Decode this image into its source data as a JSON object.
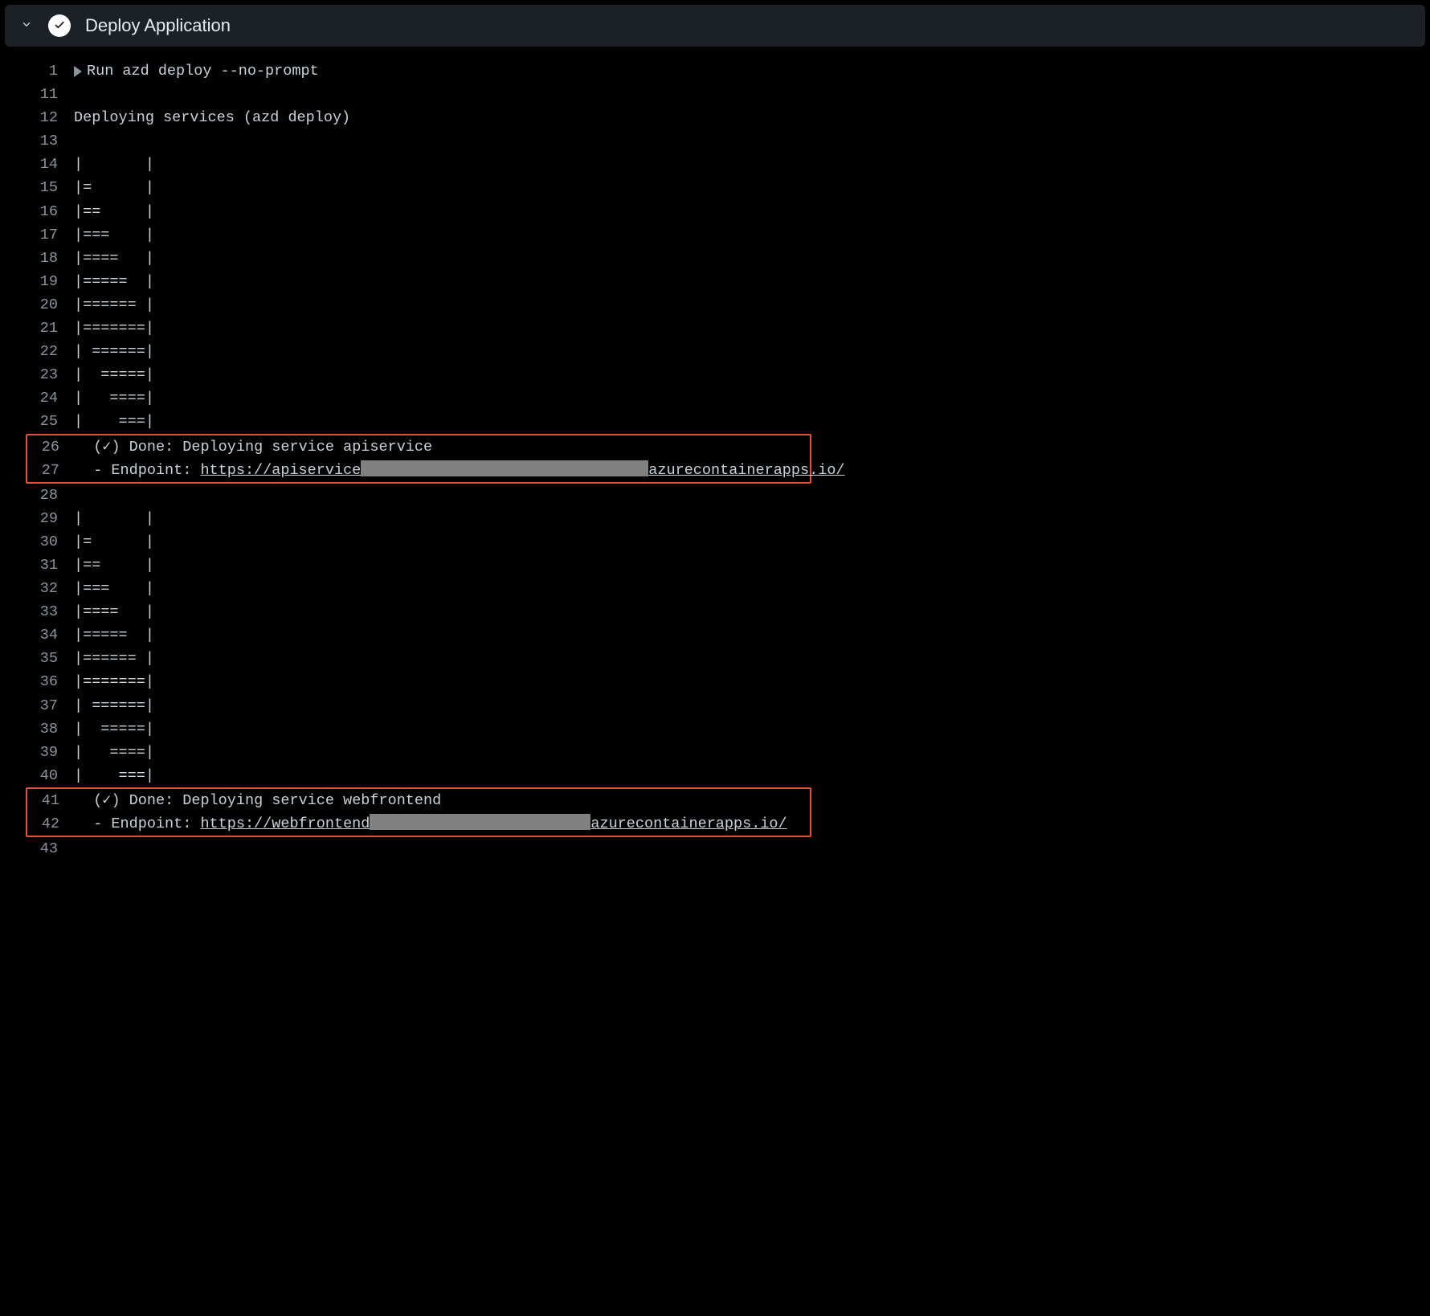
{
  "header": {
    "title": "Deploy Application"
  },
  "log": {
    "runPrefix": "Run ",
    "group1": [
      {
        "ln": "1",
        "txt": "azd deploy --no-prompt",
        "triangle": true
      },
      {
        "ln": "11",
        "txt": ""
      },
      {
        "ln": "12",
        "txt": "Deploying services (azd deploy)"
      },
      {
        "ln": "13",
        "txt": ""
      },
      {
        "ln": "14",
        "txt": "|       |"
      },
      {
        "ln": "15",
        "txt": "|=      |"
      },
      {
        "ln": "16",
        "txt": "|==     |"
      },
      {
        "ln": "17",
        "txt": "|===    |"
      },
      {
        "ln": "18",
        "txt": "|====   |"
      },
      {
        "ln": "19",
        "txt": "|=====  |"
      },
      {
        "ln": "20",
        "txt": "|====== |"
      },
      {
        "ln": "21",
        "txt": "|=======|"
      },
      {
        "ln": "22",
        "txt": "| ======|"
      },
      {
        "ln": "23",
        "txt": "|  =====|"
      },
      {
        "ln": "24",
        "txt": "|   ====|"
      },
      {
        "ln": "25",
        "txt": "|    ===|"
      }
    ],
    "highlight1": [
      {
        "ln": "26",
        "txt": "  (✓) Done: Deploying service apiservice"
      },
      {
        "ln": "27",
        "prefix": "  - Endpoint: ",
        "link_pre": "https://apiservice",
        "link_post": "azurecontainerapps.io/",
        "redact": "w1"
      }
    ],
    "group2": [
      {
        "ln": "28",
        "txt": ""
      },
      {
        "ln": "29",
        "txt": "|       |"
      },
      {
        "ln": "30",
        "txt": "|=      |"
      },
      {
        "ln": "31",
        "txt": "|==     |"
      },
      {
        "ln": "32",
        "txt": "|===    |"
      },
      {
        "ln": "33",
        "txt": "|====   |"
      },
      {
        "ln": "34",
        "txt": "|=====  |"
      },
      {
        "ln": "35",
        "txt": "|====== |"
      },
      {
        "ln": "36",
        "txt": "|=======|"
      },
      {
        "ln": "37",
        "txt": "| ======|"
      },
      {
        "ln": "38",
        "txt": "|  =====|"
      },
      {
        "ln": "39",
        "txt": "|   ====|"
      },
      {
        "ln": "40",
        "txt": "|    ===|"
      }
    ],
    "highlight2": [
      {
        "ln": "41",
        "txt": "  (✓) Done: Deploying service webfrontend"
      },
      {
        "ln": "42",
        "prefix": "  - Endpoint: ",
        "link_pre": "https://webfrontend",
        "link_post": "azurecontainerapps.io/",
        "redact": "w2"
      }
    ],
    "group3": [
      {
        "ln": "43",
        "txt": ""
      }
    ]
  }
}
